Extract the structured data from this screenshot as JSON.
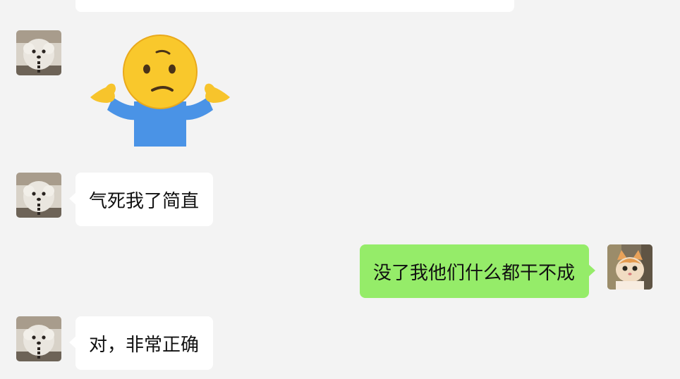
{
  "messages": [
    {
      "sender": "dog-avatar",
      "direction": "incoming",
      "type": "text",
      "text": "",
      "partial": true
    },
    {
      "sender": "dog-avatar",
      "direction": "incoming",
      "type": "sticker",
      "sticker": "shrug-emoji"
    },
    {
      "sender": "dog-avatar",
      "direction": "incoming",
      "type": "text",
      "text": "气死我了简直"
    },
    {
      "sender": "cat-avatar",
      "direction": "outgoing",
      "type": "text",
      "text": "没了我他们什么都干不成"
    },
    {
      "sender": "dog-avatar",
      "direction": "incoming",
      "type": "text",
      "text": "对，非常正确"
    }
  ],
  "colors": {
    "background": "#f3f3f3",
    "incoming_bubble": "#ffffff",
    "outgoing_bubble": "#95ec69",
    "text": "#111111"
  },
  "icons": {
    "incoming_avatar": "dog-avatar-icon",
    "outgoing_avatar": "cat-avatar-icon",
    "sticker": "shrug-emoji-icon"
  }
}
